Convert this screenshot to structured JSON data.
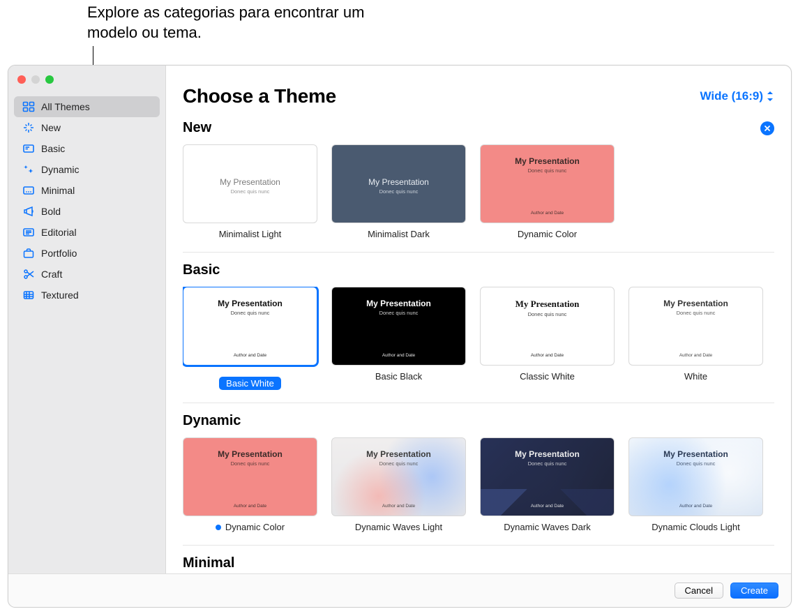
{
  "annotation": "Explore as categorias para encontrar um modelo ou tema.",
  "window": {
    "title": "Choose a Theme",
    "aspect_label": "Wide (16:9)"
  },
  "sidebar": {
    "items": [
      {
        "label": "All Themes",
        "icon": "grid-icon",
        "selected": true
      },
      {
        "label": "New",
        "icon": "sparkle-icon"
      },
      {
        "label": "Basic",
        "icon": "slide-icon"
      },
      {
        "label": "Dynamic",
        "icon": "stars-icon"
      },
      {
        "label": "Minimal",
        "icon": "dots-icon"
      },
      {
        "label": "Bold",
        "icon": "megaphone-icon"
      },
      {
        "label": "Editorial",
        "icon": "text-icon"
      },
      {
        "label": "Portfolio",
        "icon": "briefcase-icon"
      },
      {
        "label": "Craft",
        "icon": "scissors-icon"
      },
      {
        "label": "Textured",
        "icon": "texture-icon"
      }
    ]
  },
  "thumb_text": {
    "title": "My Presentation",
    "sub": "Donec quis nunc",
    "auth": "Author and Date"
  },
  "sections": [
    {
      "heading": "New",
      "dismissable": true,
      "themes": [
        {
          "label": "Minimalist Light",
          "bg": "#ffffff",
          "fg": "#7a7a7a",
          "style": "thin",
          "valign": "center"
        },
        {
          "label": "Minimalist Dark",
          "bg": "#4a5a70",
          "fg": "#e9edf2",
          "style": "thin",
          "valign": "center"
        },
        {
          "label": "Dynamic Color",
          "bg": "#f38a87",
          "fg": "#3a2a28",
          "style": "normal",
          "valign": "center"
        }
      ]
    },
    {
      "heading": "Basic",
      "themes": [
        {
          "label": "Basic White",
          "bg": "#ffffff",
          "fg": "#111111",
          "style": "normal",
          "selected": true
        },
        {
          "label": "Basic Black",
          "bg": "#000000",
          "fg": "#ffffff",
          "style": "normal"
        },
        {
          "label": "Classic White",
          "bg": "#ffffff",
          "fg": "#111111",
          "style": "serif",
          "align": "center"
        },
        {
          "label": "White",
          "bg": "#ffffff",
          "fg": "#333333",
          "style": "normal",
          "align": "center"
        }
      ],
      "peek": {
        "bg": "#000000",
        "fg": "#ffffff"
      }
    },
    {
      "heading": "Dynamic",
      "themes": [
        {
          "label": "Dynamic Color",
          "bg": "#f38a87",
          "fg": "#3a2a28",
          "style": "normal",
          "new": true,
          "valign": "center"
        },
        {
          "label": "Dynamic Waves Light",
          "bgclass": "bg-waves-light",
          "fg": "#3a3a3a",
          "style": "normal",
          "valign": "center"
        },
        {
          "label": "Dynamic Waves Dark",
          "bgclass": "bg-waves-dark triangles",
          "fg": "#eeeeee",
          "style": "normal",
          "valign": "center"
        },
        {
          "label": "Dynamic Clouds Light",
          "bgclass": "bg-clouds-light",
          "fg": "#2a3a55",
          "style": "normal",
          "valign": "center"
        }
      ],
      "peek": {
        "bg": "linear-gradient(135deg,#b48cff,#6a5cff)",
        "fg": "#ffffff"
      }
    },
    {
      "heading": "Minimal",
      "themes": []
    }
  ],
  "footer": {
    "cancel": "Cancel",
    "create": "Create"
  }
}
